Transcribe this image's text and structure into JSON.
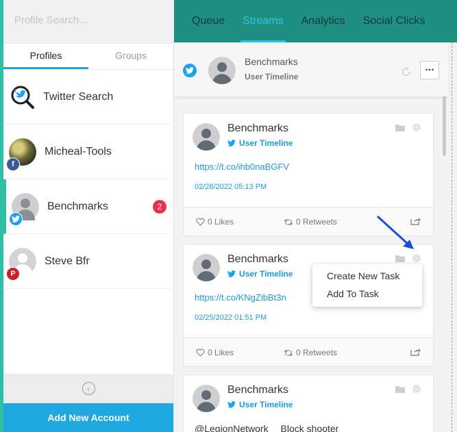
{
  "search": {
    "placeholder": "Profile Search..."
  },
  "profile_tabs": [
    {
      "label": "Profiles",
      "active": true
    },
    {
      "label": "Groups",
      "active": false
    }
  ],
  "profiles": [
    {
      "name": "Twitter Search",
      "icon": "magnifier-twitter-icon"
    },
    {
      "name": "Micheal-Tools",
      "network": "facebook"
    },
    {
      "name": "Benchmarks",
      "network": "twitter",
      "badge": "2",
      "active": true
    },
    {
      "name": "Steve Bfr",
      "network": "pinterest"
    }
  ],
  "collapse_icon": "chevron-left-circle-icon",
  "add_account_label": "Add New Account",
  "nav": {
    "tabs": [
      {
        "label": "Queue"
      },
      {
        "label": "Streams",
        "active": true
      },
      {
        "label": "Analytics"
      },
      {
        "label": "Social Clicks"
      }
    ]
  },
  "stream_header": {
    "title": "Benchmarks",
    "subtitle": "User Timeline",
    "more_label": "..."
  },
  "posts": [
    {
      "name": "Benchmarks",
      "source": "User Timeline",
      "link": "https://t.co/ihb0naBGFV",
      "date": "02/28/2022 05:13 PM",
      "likes": "0 Likes",
      "retweets": "0 Retweets"
    },
    {
      "name": "Benchmarks",
      "source": "User Timeline",
      "link": "https://t.co/KNgZibBt3n",
      "date": "02/25/2022 01:51 PM",
      "likes": "0 Likes",
      "retweets": "0 Retweets"
    },
    {
      "name": "Benchmarks",
      "source": "User Timeline",
      "text_left": "@LegionNetwork",
      "text_right": "Block shooter"
    }
  ],
  "context_menu": [
    {
      "label": "Create New Task"
    },
    {
      "label": "Add To Task"
    }
  ],
  "colors": {
    "accent": "#1fa8e0",
    "nav_bg": "#1f8f82",
    "active_tab": "#2ec6e0",
    "teal_strip": "#2fbfa6",
    "badge": "#e8324c"
  }
}
